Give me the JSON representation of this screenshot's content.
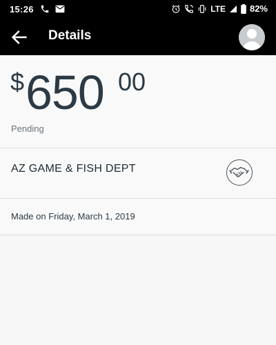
{
  "status_bar": {
    "time": "15:26",
    "network": "LTE",
    "battery": "82%",
    "icons_left": [
      "phone-icon",
      "mail-icon"
    ],
    "icons_right": [
      "alarm-icon",
      "wifi-calling-icon",
      "vibrate-icon",
      "signal-icon",
      "battery-icon"
    ]
  },
  "header": {
    "title": "Details",
    "back_icon": "arrow-left-icon",
    "avatar_icon": "avatar-icon"
  },
  "transaction": {
    "currency_symbol": "$",
    "amount_whole": "650",
    "amount_cents": "00",
    "status": "Pending",
    "merchant": "AZ GAME & FISH DEPT",
    "merchant_icon": "handshake-icon",
    "date_text": "Made on Friday, March 1, 2019"
  },
  "colors": {
    "header_bg": "#000000",
    "page_bg": "#f7f7f7",
    "text_primary": "#1f2b33",
    "text_secondary": "#6b747a",
    "divider": "#dcdcdc"
  }
}
